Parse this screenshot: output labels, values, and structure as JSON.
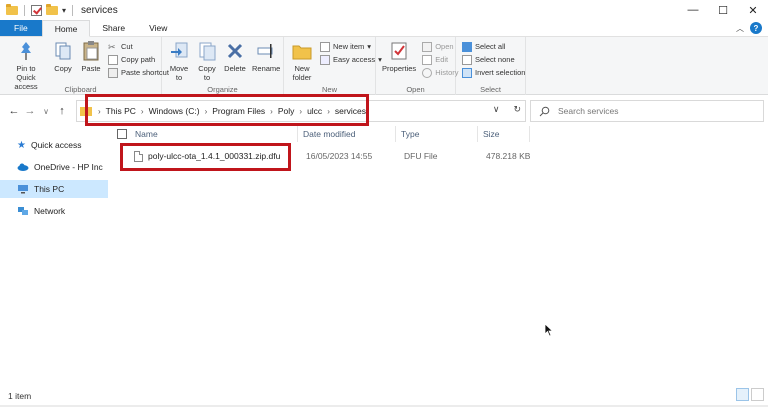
{
  "window": {
    "title": "services",
    "controls": {
      "minimize": "—",
      "maximize": "☐",
      "close": "✕"
    }
  },
  "tabs": [
    {
      "label": "File"
    },
    {
      "label": "Home"
    },
    {
      "label": "Share"
    },
    {
      "label": "View"
    }
  ],
  "ribbon": {
    "clipboard": {
      "label": "Clipboard",
      "pin": "Pin to Quick access",
      "copy": "Copy",
      "paste": "Paste",
      "cut": "Cut",
      "copy_path": "Copy path",
      "paste_shortcut": "Paste shortcut"
    },
    "organize": {
      "label": "Organize",
      "move_to": "Move to",
      "copy_to": "Copy to",
      "delete": "Delete",
      "rename": "Rename"
    },
    "new": {
      "label": "New",
      "new_folder": "New folder",
      "new_item": "New item",
      "easy_access": "Easy access"
    },
    "open": {
      "label": "Open",
      "properties": "Properties",
      "open": "Open",
      "edit": "Edit",
      "history": "History"
    },
    "select": {
      "label": "Select",
      "select_all": "Select all",
      "select_none": "Select none",
      "invert": "Invert selection"
    }
  },
  "address": {
    "crumbs": [
      "This PC",
      "Windows (C:)",
      "Program Files",
      "Poly",
      "ulcc",
      "services"
    ]
  },
  "search": {
    "placeholder": "Search services"
  },
  "nav": {
    "items": [
      {
        "label": "Quick access"
      },
      {
        "label": "OneDrive - HP Inc"
      },
      {
        "label": "This PC"
      },
      {
        "label": "Network"
      }
    ]
  },
  "columns": {
    "name": "Name",
    "date": "Date modified",
    "type": "Type",
    "size": "Size"
  },
  "files": [
    {
      "name": "poly-ulcc-ota_1.4.1_000331.zip.dfu",
      "date": "16/05/2023 14:55",
      "type": "DFU File",
      "size": "478.218 KB"
    }
  ],
  "status": {
    "count": "1 item"
  },
  "colors": {
    "accent": "#1979ca",
    "highlight_box": "#c0151b",
    "selected_nav": "#cce8ff"
  }
}
